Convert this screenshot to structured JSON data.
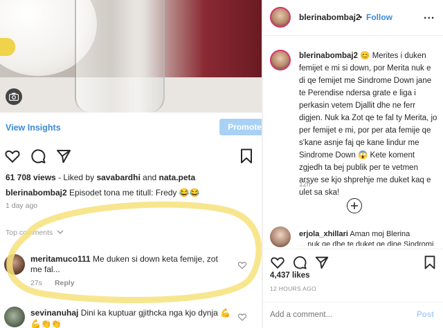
{
  "left_post": {
    "view_insights": "View Insights",
    "promote": "Promote",
    "views_count": "61 708 views",
    "liked_by_prefix": " - Liked by ",
    "liked_user_1": "savabardhi",
    "liked_and": " and ",
    "liked_user_2": "nata.peta",
    "caption_user": "blerinabombaj2",
    "caption_text": " Episodet tona me titull: Fredy 😂😂",
    "time_ago": "1 day ago",
    "top_comments": "Top comments",
    "comments": [
      {
        "user": "meritamuco111",
        "text": " Me duken si down keta femije, zot me fal...",
        "age": "27s",
        "reply": "Reply"
      },
      {
        "user": "sevinanuhaj",
        "text": " Dini ka kuptuar gjithcka nga kjo dynja 💪💪👏👏"
      }
    ]
  },
  "right_panel": {
    "header": {
      "username": "blerinabombaj2",
      "dot": "•",
      "follow": "Follow",
      "more": "..."
    },
    "post": {
      "username": "blerinabombaj2",
      "text": " 😊 Merites i duken femijet e mi si down, por Merita nuk e di qe femijet me Sindrome Down jane te Perendise ndersa grate e liga i perkasin vetem Djallit dhe ne ferr digjen. Nuk ka Zot qe te fal ty Merita, jo per femijet e mi, por per ata femije qe s'kane asnje faj qe kane lindur me Sindrome Down 😱 Kete koment zgjedh ta bej publik per te vetmen arsye se kjo shprehje me duket kaq e ulet sa ska!",
      "time": "12h"
    },
    "reply_comment": {
      "user": "erjola_xhillari",
      "text": " Aman moj Blerina",
      "cut_text": "... nuk qe dhe te duket qe dine Sindromi kujdesun"
    },
    "likes": "4,437 likes",
    "timestamp": "12 HOURS AGO",
    "add_comment_placeholder": "Add a comment...",
    "post_button": "Post"
  }
}
